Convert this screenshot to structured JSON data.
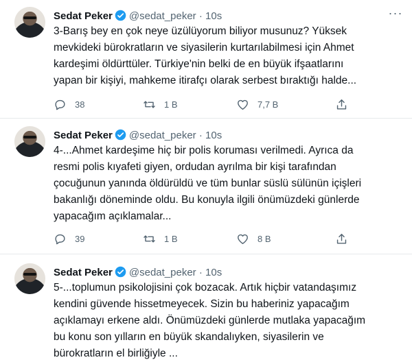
{
  "tweets": [
    {
      "name": "Sedat Peker",
      "handle": "@sedat_peker",
      "dot": "·",
      "time": "10s",
      "text": "3-Barış bey en çok neye üzülüyorum biliyor musunuz? Yüksek\nmevkideki bürokratların ve siyasilerin kurtarılabilmesi için Ahmet\nkardeşimi öldürttüler. Türkiye'nin belki de en büyük ifşaatlarını\nyapan bir kişiyi, mahkeme itirafçı olarak serbest bıraktığı halde...",
      "replies": "38",
      "retweets": "1 B",
      "likes": "7,7 B"
    },
    {
      "name": "Sedat Peker",
      "handle": "@sedat_peker",
      "dot": "·",
      "time": "10s",
      "text": "4-...Ahmet kardeşime hiç bir polis koruması verilmedi. Ayrıca da\nresmi polis kıyafeti giyen, ordudan ayrılma bir kişi tarafından\nçocuğunun yanında öldürüldü ve tüm bunlar süslü sülünün içişleri\nbakanlığı döneminde oldu. Bu konuyla ilgili önümüzdeki günlerde\nyapacağım açıklamalar...",
      "replies": "39",
      "retweets": "1 B",
      "likes": "8 B"
    },
    {
      "name": "Sedat Peker",
      "handle": "@sedat_peker",
      "dot": "·",
      "time": "10s",
      "text": "5-...toplumun psikolojisini çok bozacak. Artık hiçbir vatandaşımız\nkendini güvende hissetmeyecek. Sizin bu haberiniz yapacağım\naçıklamayı erkene aldı. Önümüzdeki günlerde mutlaka yapacağım\nbu konu son yılların en büyük skandalıyken, siyasilerin ve\nbürokratların el birliğiyle ..."
    }
  ],
  "icons": {
    "verified": "verified-badge-icon",
    "more": "more-options-icon",
    "reply": "reply-icon",
    "retweet": "retweet-icon",
    "like": "heart-icon",
    "share": "share-icon"
  },
  "colors": {
    "accent": "#1d9bf0",
    "secondary_text": "#536471"
  }
}
